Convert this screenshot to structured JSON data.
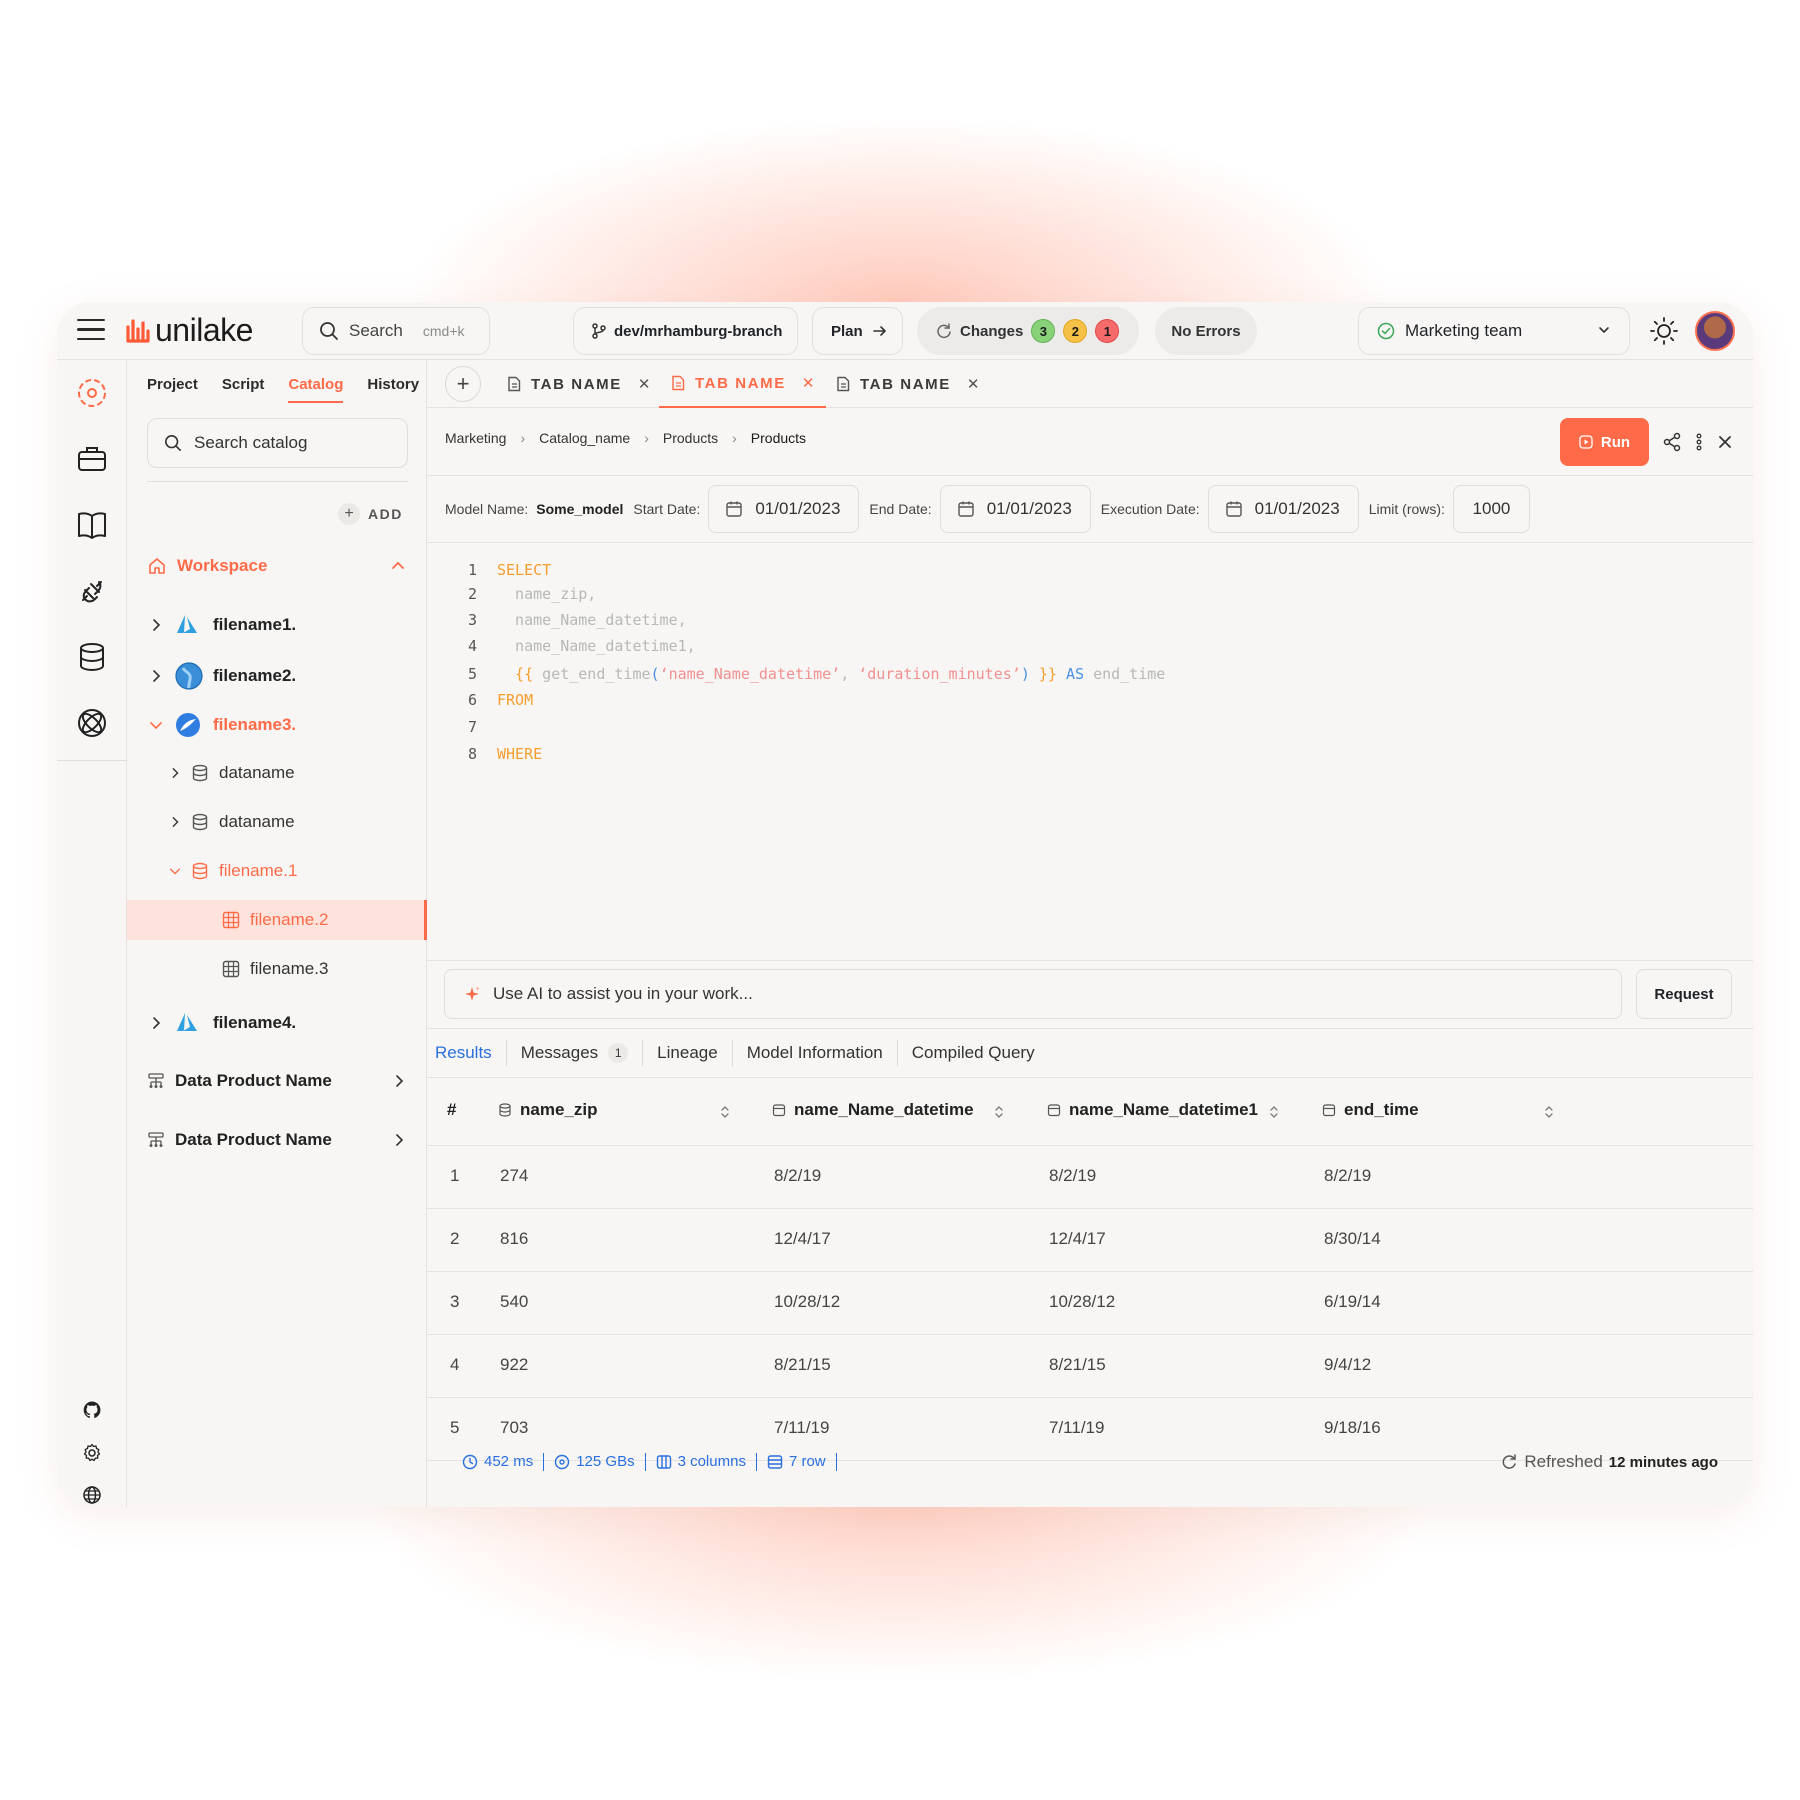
{
  "brand": {
    "name": "unilake"
  },
  "topbar": {
    "search_placeholder": "Search",
    "search_shortcut": "cmd+k",
    "branch": "dev/mrhamburg-branch",
    "plan_label": "Plan",
    "changes_label": "Changes",
    "changes_counts": [
      "3",
      "2",
      "1"
    ],
    "errors_label": "No Errors",
    "team": "Marketing team"
  },
  "sidebar": {
    "tabs": [
      "Project",
      "Script",
      "Catalog",
      "History"
    ],
    "active_tab": "Catalog",
    "search_placeholder": "Search catalog",
    "add_label": "ADD",
    "workspace_label": "Workspace",
    "tree": {
      "file1": "filename1.",
      "file2": "filename2.",
      "file3": "filename3.",
      "data1": "dataname",
      "data2": "dataname",
      "sub1": "filename.1",
      "sub2": "filename.2",
      "sub3": "filename.3",
      "file4": "filename4."
    },
    "products": [
      "Data Product Name",
      "Data Product Name"
    ]
  },
  "editor_tabs": [
    {
      "label": "TAB NAME",
      "active": false
    },
    {
      "label": "TAB NAME",
      "active": true
    },
    {
      "label": "TAB NAME",
      "active": false
    }
  ],
  "breadcrumb": [
    "Marketing",
    "Catalog_name",
    "Products",
    "Products"
  ],
  "run_label": "Run",
  "params": {
    "model_label": "Model Name:",
    "model_value": "Some_model",
    "start_label": "Start Date:",
    "start_value": "01/01/2023",
    "end_label": "End Date:",
    "end_value": "01/01/2023",
    "exec_label": "Execution Date:",
    "exec_value": "01/01/2023",
    "limit_label": "Limit (rows):",
    "limit_value": "1000"
  },
  "code": {
    "l1": "SELECT",
    "l2": "  name_zip,",
    "l3": "  name_Name_datetime,",
    "l4": "  name_Name_datetime1,",
    "l5_open": "  {{ ",
    "l5_fn": "get_end_time",
    "l5_p1": "(",
    "l5_s1": "‘name_Name_datetime’",
    "l5_comma": ", ",
    "l5_s2": "‘duration_minutes’",
    "l5_p2": ")",
    "l5_close": " }}",
    "l5_as": " AS ",
    "l5_alias": "end_time",
    "l6": "FROM",
    "l7": "",
    "l8": "WHERE"
  },
  "ai": {
    "placeholder": "Use AI to assist you in your work...",
    "request_label": "Request"
  },
  "result_tabs": {
    "results": "Results",
    "messages": "Messages",
    "messages_count": "1",
    "lineage": "Lineage",
    "model_info": "Model Information",
    "compiled": "Compiled Query"
  },
  "table": {
    "hash": "#",
    "columns": [
      "name_zip",
      "name_Name_datetime",
      "name_Name_datetime1",
      "end_time"
    ],
    "rows": [
      [
        "1",
        "274",
        "8/2/19",
        "8/2/19",
        "8/2/19"
      ],
      [
        "2",
        "816",
        "12/4/17",
        "12/4/17",
        "8/30/14"
      ],
      [
        "3",
        "540",
        "10/28/12",
        "10/28/12",
        "6/19/14"
      ],
      [
        "4",
        "922",
        "8/21/15",
        "8/21/15",
        "9/4/12"
      ],
      [
        "5",
        "703",
        "7/11/19",
        "7/11/19",
        "9/18/16"
      ]
    ]
  },
  "footer": {
    "time": "452 ms",
    "size": "125 GBs",
    "columns": "3 columns",
    "rows": "7 row",
    "refreshed_label": "Refreshed",
    "refreshed_when": "12 minutes ago"
  },
  "colors": {
    "accent": "#ff6a48",
    "link": "#2a6fe0",
    "keyword": "#f59e2c"
  }
}
